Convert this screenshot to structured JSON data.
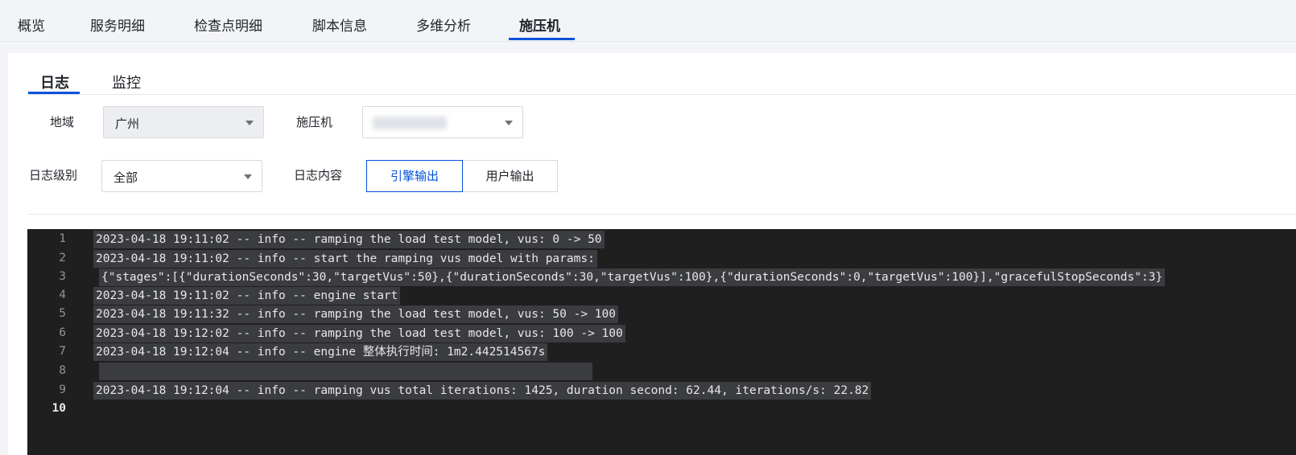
{
  "top_tabs": [
    {
      "label": "概览",
      "active": false
    },
    {
      "label": "服务明细",
      "active": false
    },
    {
      "label": "检查点明细",
      "active": false
    },
    {
      "label": "脚本信息",
      "active": false
    },
    {
      "label": "多维分析",
      "active": false
    },
    {
      "label": "施压机",
      "active": true
    }
  ],
  "sub_tabs": [
    {
      "label": "日志",
      "active": true
    },
    {
      "label": "监控",
      "active": false
    }
  ],
  "filters": {
    "region_label": "地域",
    "region_value": "广州",
    "machine_label": "施压机",
    "machine_value_blurred": true,
    "log_level_label": "日志级别",
    "log_level_value": "全部",
    "log_content_label": "日志内容",
    "log_content_options": [
      {
        "label": "引擎输出",
        "active": true
      },
      {
        "label": "用户输出",
        "active": false
      }
    ]
  },
  "log": {
    "current_line": 10,
    "lines": [
      {
        "n": "1",
        "text": "2023-04-18 19:11:02 -- info -- ramping the load test model, vus: 0 -> 50"
      },
      {
        "n": "2",
        "text": "2023-04-18 19:11:02 -- info -- start the ramping vus model with params:"
      },
      {
        "n": "3",
        "text": "{\"stages\":[{\"durationSeconds\":30,\"targetVus\":50},{\"durationSeconds\":30,\"targetVus\":100},{\"durationSeconds\":0,\"targetVus\":100}],\"gracefulStopSeconds\":3}"
      },
      {
        "n": "4",
        "text": "2023-04-18 19:11:02 -- info -- engine start"
      },
      {
        "n": "5",
        "text": "2023-04-18 19:11:32 -- info -- ramping the load test model, vus: 50 -> 100"
      },
      {
        "n": "6",
        "text": "2023-04-18 19:12:02 -- info -- ramping the load test model, vus: 100 -> 100"
      },
      {
        "n": "7",
        "text": "2023-04-18 19:12:04 -- info -- engine 整体执行时间: 1m2.442514567s"
      },
      {
        "n": "8",
        "text": " "
      },
      {
        "n": "9",
        "text": "2023-04-18 19:12:04 -- info -- ramping vus total iterations: 1425, duration second: 62.44, iterations/s: 22.82"
      },
      {
        "n": "10",
        "text": ""
      }
    ]
  },
  "colors": {
    "accent": "#0052d9",
    "log_bg": "#1f1f1f",
    "log_highlight": "#3b3c40"
  }
}
